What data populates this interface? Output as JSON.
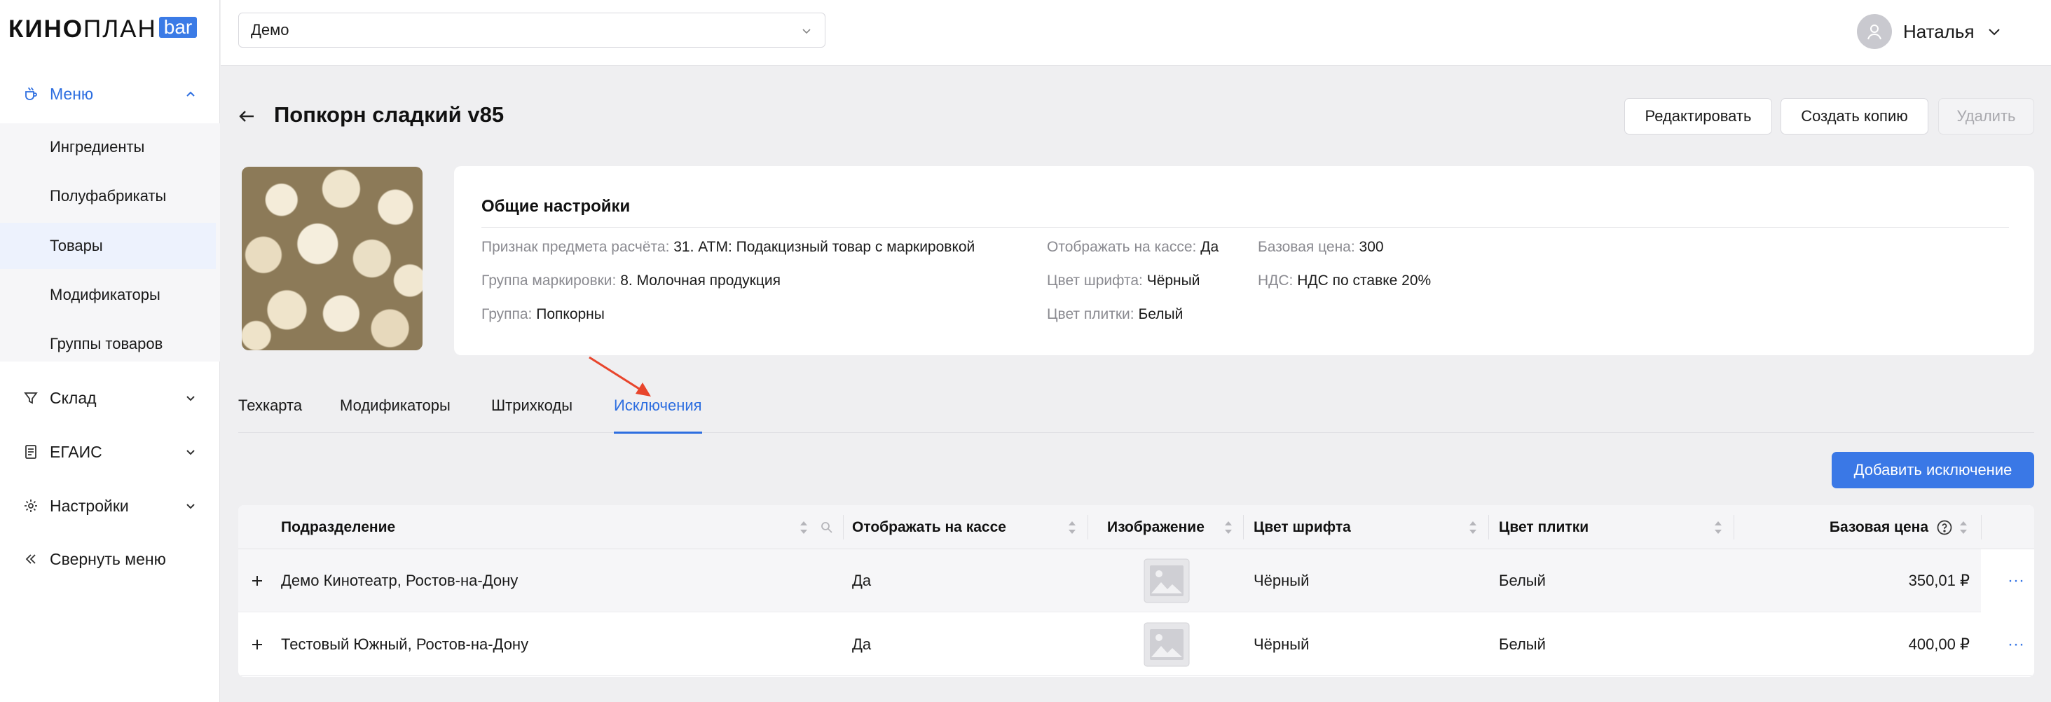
{
  "logo": {
    "bold": "КИНО",
    "thin": "ПЛАН",
    "badge": "bar"
  },
  "sidebar": {
    "menu_label": "Меню",
    "submenu": [
      "Ингредиенты",
      "Полуфабрикаты",
      "Товары",
      "Модификаторы",
      "Группы товаров"
    ],
    "selected_submenu": "Товары",
    "groups": [
      {
        "label": "Склад",
        "icon": "funnel-icon"
      },
      {
        "label": "ЕГАИС",
        "icon": "document-icon"
      },
      {
        "label": "Настройки",
        "icon": "gear-icon"
      }
    ],
    "collapse_label": "Свернуть меню"
  },
  "topbar": {
    "organization": "Демо",
    "user_name": "Наталья"
  },
  "page": {
    "title": "Попкорн сладкий v85",
    "buttons": {
      "edit": "Редактировать",
      "copy": "Создать копию",
      "delete": "Удалить"
    }
  },
  "settings": {
    "title": "Общие настройки",
    "fields": {
      "payment_subject": {
        "key": "Признак предмета расчёта:",
        "value": "31. АТМ: Подакцизный товар с маркировкой"
      },
      "marking_group": {
        "key": "Группа маркировки:",
        "value": "8. Молочная продукция"
      },
      "group": {
        "key": "Группа:",
        "value": "Попкорны"
      },
      "show_on_cashbox": {
        "key": "Отображать на кассе:",
        "value": "Да"
      },
      "font_color": {
        "key": "Цвет шрифта:",
        "value": "Чёрный"
      },
      "tile_color": {
        "key": "Цвет плитки:",
        "value": "Белый"
      },
      "base_price": {
        "key": "Базовая цена:",
        "value": "300"
      },
      "vat": {
        "key": "НДС:",
        "value": "НДС по ставке 20%"
      }
    }
  },
  "tabs": [
    "Техкарта",
    "Модификаторы",
    "Штрихкоды",
    "Исключения"
  ],
  "active_tab": "Исключения",
  "add_button": "Добавить исключение",
  "table": {
    "columns": [
      "Подразделение",
      "Отображать на кассе",
      "Изображение",
      "Цвет шрифта",
      "Цвет плитки",
      "Базовая цена"
    ],
    "rows": [
      {
        "division": "Демо Кинотеатр, Ростов-на-Дону",
        "show": "Да",
        "font_color": "Чёрный",
        "tile_color": "Белый",
        "price": "350,01 ₽"
      },
      {
        "division": "Тестовый Южный, Ростов-на-Дону",
        "show": "Да",
        "font_color": "Чёрный",
        "tile_color": "Белый",
        "price": "400,00 ₽"
      }
    ],
    "more_label": "···"
  },
  "colors": {
    "accent": "#2d6ee0",
    "primary_button": "#3a78e6",
    "annotation_arrow": "#e8452c",
    "page_bg": "#efeff1"
  }
}
